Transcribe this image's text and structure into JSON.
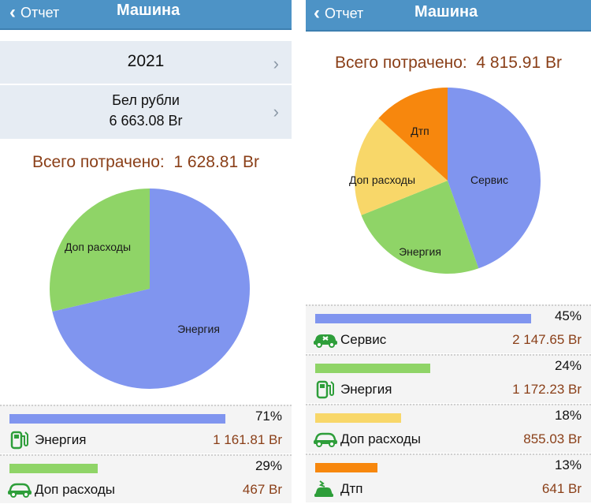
{
  "colors": {
    "nav": "#4d93c6",
    "total": "#8a3f18",
    "blue": "#8095ef",
    "green": "#8fd467",
    "yellow": "#f8d769",
    "orange": "#f7870d"
  },
  "left": {
    "nav": {
      "back_label": "Отчет",
      "title": "Машина"
    },
    "period": {
      "year": "2021",
      "currency": "Бел рубли",
      "balance": "6 663.08 Br"
    },
    "total": {
      "label": "Всего потрачено:",
      "value": "1 628.81 Br"
    },
    "chart_data": {
      "type": "pie",
      "slices": [
        {
          "label": "Энергия",
          "value": 71.33,
          "color": "#8095ef"
        },
        {
          "label": "Доп расходы",
          "value": 28.67,
          "color": "#8fd467"
        }
      ]
    },
    "items": [
      {
        "percent_text": "71%",
        "fraction": 0.71,
        "color": "#8095ef",
        "icon": "fuel-pump-icon",
        "label": "Энергия",
        "amount": "1 161.81 Br"
      },
      {
        "percent_text": "29%",
        "fraction": 0.29,
        "color": "#8fd467",
        "icon": "car-icon",
        "label": "Доп расходы",
        "amount": "467 Br"
      }
    ]
  },
  "right": {
    "nav": {
      "back_label": "Отчет",
      "title": "Машина"
    },
    "total": {
      "label": "Всего потрачено:",
      "value": "4 815.91 Br"
    },
    "chart_data": {
      "type": "pie",
      "slices": [
        {
          "label": "Сервис",
          "value": 44.6,
          "color": "#8095ef"
        },
        {
          "label": "Энергия",
          "value": 24.34,
          "color": "#8fd467"
        },
        {
          "label": "Доп расходы",
          "value": 17.75,
          "color": "#f8d769"
        },
        {
          "label": "Дтп",
          "value": 13.31,
          "color": "#f7870d"
        }
      ]
    },
    "items": [
      {
        "percent_text": "45%",
        "fraction": 0.45,
        "color": "#8095ef",
        "icon": "car-service-icon",
        "label": "Сервис",
        "amount": "2 147.65 Br"
      },
      {
        "percent_text": "24%",
        "fraction": 0.24,
        "color": "#8fd467",
        "icon": "fuel-pump-icon",
        "label": "Энергия",
        "amount": "1 172.23 Br"
      },
      {
        "percent_text": "18%",
        "fraction": 0.18,
        "color": "#f8d769",
        "icon": "car-icon",
        "label": "Доп расходы",
        "amount": "855.03 Br"
      },
      {
        "percent_text": "13%",
        "fraction": 0.13,
        "color": "#f7870d",
        "icon": "accident-icon",
        "label": "Дтп",
        "amount": "641 Br"
      }
    ]
  }
}
